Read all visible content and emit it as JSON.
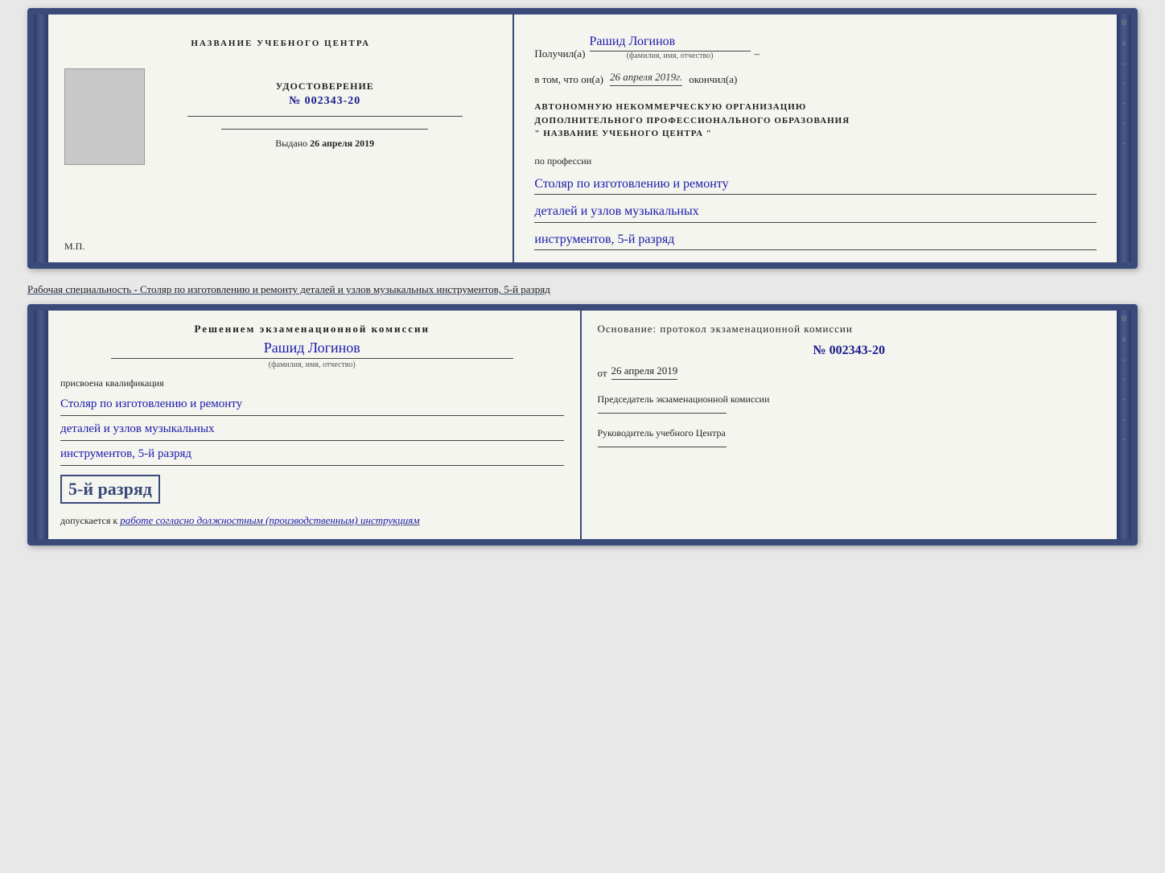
{
  "top_book": {
    "left": {
      "center_title": "НАЗВАНИЕ УЧЕБНОГО ЦЕНТРА",
      "photo_alt": "фото",
      "cert_label": "УДОСТОВЕРЕНИЕ",
      "cert_number_prefix": "№",
      "cert_number": "002343-20",
      "issued_label": "Выдано",
      "issued_date": "26 апреля 2019",
      "mp_label": "М.П."
    },
    "right": {
      "received_label": "Получил(а)",
      "recipient_name": "Рашид Логинов",
      "fio_sublabel": "(фамилия, имя, отчество)",
      "dash": "–",
      "in_that_label": "в том, что он(а)",
      "completion_date": "26 апреля 2019г.",
      "completed_label": "окончил(а)",
      "org_line1": "АВТОНОМНУЮ НЕКОММЕРЧЕСКУЮ ОРГАНИЗАЦИЮ",
      "org_line2": "ДОПОЛНИТЕЛЬНОГО ПРОФЕССИОНАЛЬНОГО ОБРАЗОВАНИЯ",
      "org_line3": "\"  НАЗВАНИЕ УЧЕБНОГО ЦЕНТРА  \"",
      "profession_label": "по профессии",
      "profession_line1": "Столяр по изготовлению и ремонту",
      "profession_line2": "деталей и узлов музыкальных",
      "profession_line3": "инструментов, 5-й разряд"
    }
  },
  "working_specialty": "Рабочая специальность - Столяр по изготовлению и ремонту деталей и узлов музыкальных инструментов, 5-й разряд",
  "bottom_book": {
    "left": {
      "decision_title": "Решением экзаменационной комиссии",
      "person_name": "Рашид Логинов",
      "fio_sublabel": "(фамилия, имя, отчество)",
      "assigned_label": "присвоена квалификация",
      "qualification_line1": "Столяр по изготовлению и ремонту",
      "qualification_line2": "деталей и узлов музыкальных",
      "qualification_line3": "инструментов, 5-й разряд",
      "rank_text": "5-й разряд",
      "admitted_prefix": "допускается к",
      "admitted_handwritten": "работе согласно должностным (производственным) инструкциям"
    },
    "right": {
      "basis_text": "Основание: протокол экзаменационной комиссии",
      "protocol_number": "№  002343-20",
      "from_prefix": "от",
      "from_date": "26 апреля 2019",
      "chairman_title": "Председатель экзаменационной комиссии",
      "center_head_title": "Руководитель учебного Центра"
    }
  },
  "spine_right_marks": [
    "И",
    "а",
    "←",
    "–",
    "–",
    "–",
    "–"
  ]
}
